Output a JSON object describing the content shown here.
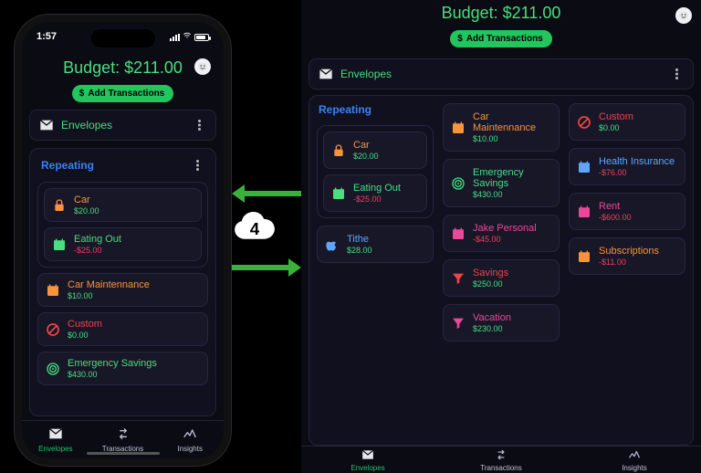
{
  "budget_label": "Budget: $211.00",
  "add_btn_label": "Add Transactions",
  "envelopes_label": "Envelopes",
  "section_title": "Repeating",
  "status_time": "1:57",
  "tabs": {
    "envelopes": "Envelopes",
    "transactions": "Transactions",
    "insights": "Insights"
  },
  "phone_repeating": [
    {
      "name": "Car",
      "amount": "$20.00",
      "name_cls": "c-orange",
      "amt_cls": "amt-green",
      "icon": "lock"
    },
    {
      "name": "Eating Out",
      "amount": "-$25.00",
      "name_cls": "c-green",
      "amt_cls": "amt-red",
      "icon": "cal"
    }
  ],
  "phone_rest": [
    {
      "name": "Car Maintennance",
      "amount": "$10.00",
      "name_cls": "c-orange",
      "amt_cls": "amt-green",
      "icon": "cal"
    },
    {
      "name": "Custom",
      "amount": "$0.00",
      "name_cls": "c-red",
      "amt_cls": "amt-green",
      "icon": "block"
    },
    {
      "name": "Emergency Savings",
      "amount": "$430.00",
      "name_cls": "c-green",
      "amt_cls": "amt-green",
      "icon": "target"
    }
  ],
  "tablet_left_repeating": [
    {
      "name": "Car",
      "amount": "$20.00",
      "name_cls": "c-orange",
      "amt_cls": "amt-green",
      "icon": "lock"
    },
    {
      "name": "Eating Out",
      "amount": "-$25.00",
      "name_cls": "c-green",
      "amt_cls": "amt-red",
      "icon": "cal"
    }
  ],
  "tablet_left_rest": [
    {
      "name": "Tithe",
      "amount": "$28.00",
      "name_cls": "c-blue",
      "amt_cls": "amt-green",
      "icon": "apple"
    }
  ],
  "tablet_mid": [
    {
      "name": "Car Maintennance",
      "amount": "$10.00",
      "name_cls": "c-orange",
      "amt_cls": "amt-green",
      "icon": "cal"
    },
    {
      "name": "Emergency Savings",
      "amount": "$430.00",
      "name_cls": "c-green",
      "amt_cls": "amt-green",
      "icon": "target"
    },
    {
      "name": "Jake Personal",
      "amount": "-$45.00",
      "name_cls": "c-pink",
      "amt_cls": "amt-red",
      "icon": "cal"
    },
    {
      "name": "Savings",
      "amount": "$250.00",
      "name_cls": "c-red",
      "amt_cls": "amt-green",
      "icon": "funnel"
    },
    {
      "name": "Vacation",
      "amount": "$230.00",
      "name_cls": "c-pink",
      "amt_cls": "amt-green",
      "icon": "funnel"
    }
  ],
  "tablet_right": [
    {
      "name": "Custom",
      "amount": "$0.00",
      "name_cls": "c-red",
      "amt_cls": "amt-green",
      "icon": "block"
    },
    {
      "name": "Health Insurance",
      "amount": "-$76.00",
      "name_cls": "c-blue",
      "amt_cls": "amt-red",
      "icon": "cal"
    },
    {
      "name": "Rent",
      "amount": "-$600.00",
      "name_cls": "c-pink",
      "amt_cls": "amt-red",
      "icon": "cal"
    },
    {
      "name": "Subscriptions",
      "amount": "-$11.00",
      "name_cls": "c-orange",
      "amt_cls": "amt-red",
      "icon": "cal"
    }
  ]
}
